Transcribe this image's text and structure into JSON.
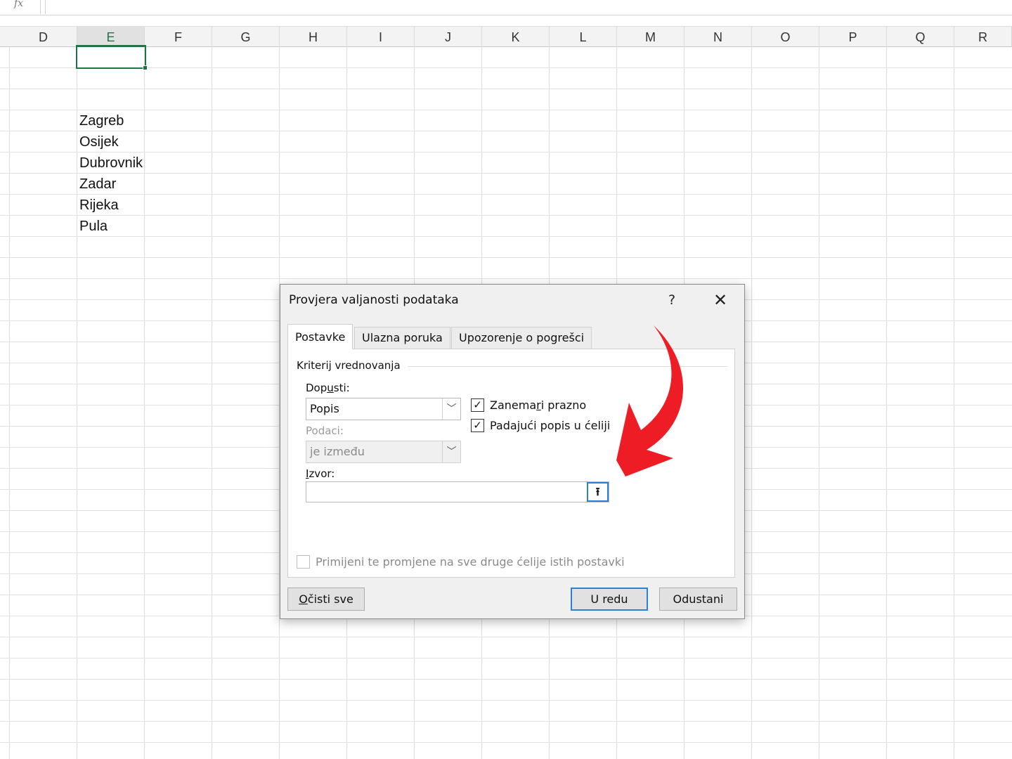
{
  "formula_bar": {
    "fx_label": "fx",
    "value": ""
  },
  "columns": [
    "D",
    "E",
    "F",
    "G",
    "H",
    "I",
    "J",
    "K",
    "L",
    "M",
    "N",
    "O",
    "P",
    "Q",
    "R"
  ],
  "active_column": "E",
  "cells": {
    "e4": "Zagreb",
    "e5": "Osijek",
    "e6": "Dubrovnik",
    "e7": "Zadar",
    "e8": "Rijeka",
    "e9": "Pula"
  },
  "dialog": {
    "title": "Provjera valjanosti podataka",
    "help_label": "?",
    "close_label": "✕",
    "tabs": [
      {
        "label": "Postavke",
        "active": true
      },
      {
        "label": "Ulazna poruka",
        "active": false
      },
      {
        "label": "Upozorenje o pogrešci",
        "active": false
      }
    ],
    "section_title": "Kriterij vrednovanja",
    "allow": {
      "label_pre": "Dop",
      "label_ul": "u",
      "label_post": "sti:",
      "value": "Popis"
    },
    "data": {
      "label": "Podaci:",
      "value": "je između",
      "disabled": true
    },
    "source": {
      "label_ul": "I",
      "label_post": "zvor:",
      "value": "",
      "collapse_icon": "⭱"
    },
    "ignore_blank": {
      "label_pre": "Zanema",
      "label_ul": "r",
      "label_post": "i prazno",
      "checked": true
    },
    "in_cell_dropdown": {
      "label_pre": "Pada",
      "label_ul": "j",
      "label_post": "ući popis u ćeliji",
      "checked": true
    },
    "apply_all": {
      "label": "Primijeni te promjene na sve druge ćelije istih postavki",
      "checked": false,
      "disabled": true
    },
    "buttons": {
      "clear_all_ul": "O",
      "clear_all_post": "čisti sve",
      "ok": "U redu",
      "cancel": "Odustani"
    },
    "check_mark": "✓",
    "dropdown_icon": "﹀"
  },
  "annotation_arrow": {
    "color": "#ee1c25"
  }
}
